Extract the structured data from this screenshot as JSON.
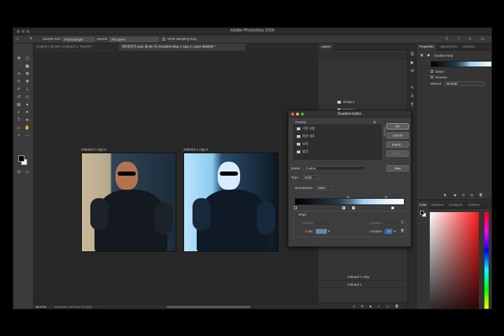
{
  "window": {
    "title": "Adobe Photoshop 2026"
  },
  "options_bar": {
    "sample_size_label": "Sample Size:",
    "sample_size_value": "Point Sample",
    "sample_label": "Sample:",
    "sample_value": "All Layers",
    "show_ring_label": "Show Sampling Ring"
  },
  "tabs": [
    {
      "label": "Untitled-1 @ 89% (Artboard 2, RGB/8*) *"
    },
    {
      "label": "색보정하기.psdc @ 66.7% (Gradient Map 1 copy 2, Layer Mask/8) *"
    }
  ],
  "canvas": {
    "artboards": [
      {
        "label": "Artboard 1 copy 3"
      },
      {
        "label": "Artboard 1 copy 4"
      }
    ]
  },
  "status": {
    "zoom": "66.67%",
    "doc_info": "2134 px x 3472 px (72 ppi)"
  },
  "layers_panel": {
    "tab": "Layers",
    "rows": [
      {
        "label": "Group 4"
      },
      {
        "label": "Group 1"
      },
      {
        "label": "Artboard 1 copy 4"
      },
      {
        "label": "Group 5"
      },
      {
        "label": "Artboard 1 copy"
      },
      {
        "label": "Artboard 1"
      }
    ]
  },
  "properties_panel": {
    "tabs": [
      "Properties",
      "Adjustments",
      "Libraries"
    ],
    "title": "Gradient Map",
    "dither": "Dither",
    "reverse": "Reverse",
    "method_label": "Method:",
    "method_value": "Smooth"
  },
  "color_panel": {
    "tabs": [
      "Color",
      "Swatches",
      "Gradients",
      "Patterns"
    ]
  },
  "gradient_editor": {
    "title": "Gradient Editor",
    "presets_label": "Presets",
    "presets": [
      "기본 사항",
      "파란 색조",
      "보라",
      "핑크"
    ],
    "buttons": {
      "ok": "OK",
      "cancel": "Cancel",
      "import": "Import...",
      "export": "Export...",
      "new": "New"
    },
    "name_label": "Name:",
    "name_value": "Custom",
    "type_label": "Type:",
    "type_value": "Solid",
    "smoothness_label": "Smoothness:",
    "smoothness_value": "100%",
    "stops_label": "Stops",
    "opacity_label": "Opacity:",
    "location_label": "Location:",
    "color_label": "Color:",
    "location_value": "45",
    "selected_color": "#5a8cb5"
  }
}
